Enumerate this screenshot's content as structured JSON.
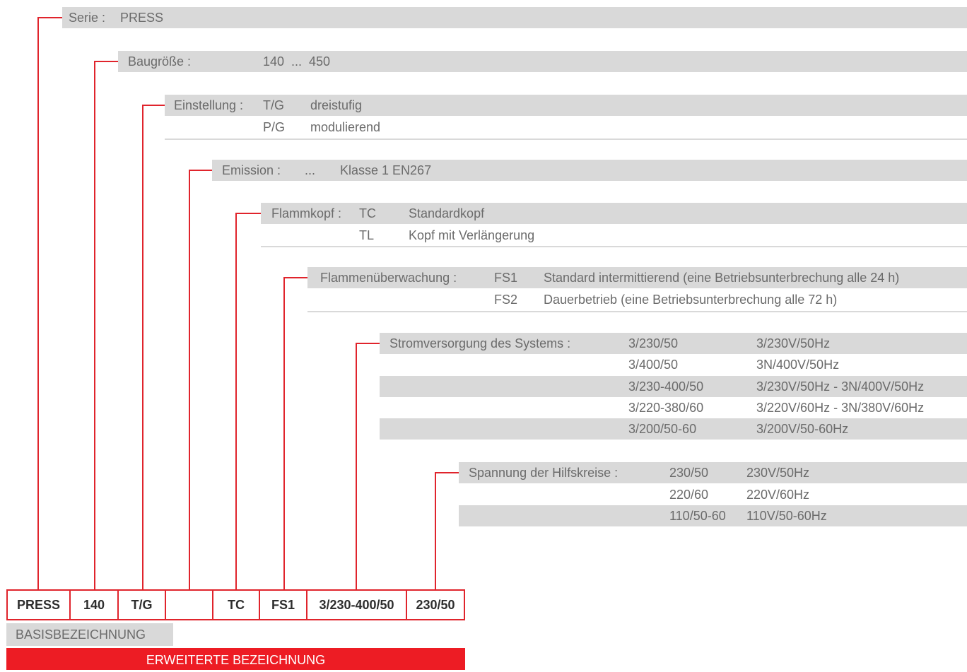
{
  "serie": {
    "label": "Serie :",
    "value": "PRESS"
  },
  "baugroesse": {
    "label": "Baugröße :",
    "value": "140  ...  450"
  },
  "einstellung": {
    "label": "Einstellung :",
    "rows": [
      {
        "code": "T/G",
        "desc": "dreistufig"
      },
      {
        "code": "P/G",
        "desc": "modulierend"
      }
    ]
  },
  "emission": {
    "label": "Emission :",
    "code": "...",
    "desc": "Klasse 1 EN267"
  },
  "flammkopf": {
    "label": "Flammkopf :",
    "rows": [
      {
        "code": "TC",
        "desc": "Standardkopf"
      },
      {
        "code": "TL",
        "desc": "Kopf mit Verlängerung"
      }
    ]
  },
  "flammen": {
    "label": "Flammenüberwachung :",
    "rows": [
      {
        "code": "FS1",
        "desc": "Standard intermittierend (eine Betriebsunterbrechung alle 24 h)"
      },
      {
        "code": "FS2",
        "desc": "Dauerbetrieb (eine Betriebsunterbrechung alle 72 h)"
      }
    ]
  },
  "strom": {
    "label": "Stromversorgung des Systems :",
    "rows": [
      {
        "code": "3/230/50",
        "desc": "3/230V/50Hz"
      },
      {
        "code": "3/400/50",
        "desc": "3N/400V/50Hz"
      },
      {
        "code": "3/230-400/50",
        "desc": "3/230V/50Hz - 3N/400V/50Hz"
      },
      {
        "code": "3/220-380/60",
        "desc": "3/220V/60Hz - 3N/380V/60Hz"
      },
      {
        "code": "3/200/50-60",
        "desc": "3/200V/50-60Hz"
      }
    ]
  },
  "hilfs": {
    "label": "Spannung der Hilfskreise :",
    "rows": [
      {
        "code": "230/50",
        "desc": "230V/50Hz"
      },
      {
        "code": "220/60",
        "desc": "220V/60Hz"
      },
      {
        "code": "110/50-60",
        "desc": "110V/50-60Hz"
      }
    ]
  },
  "code_boxes": [
    "PRESS",
    "140",
    "T/G",
    "",
    "TC",
    "FS1",
    "3/230-400/50",
    "230/50"
  ],
  "basis_label": "BASISBEZEICHNUNG",
  "erweiterte_label": "ERWEITERTE BEZEICHNUNG",
  "colors": {
    "accent": "#e0242c",
    "band": "#d9d9d9",
    "text": "#6b6b6b",
    "box_text": "#2e2e2e",
    "bar": "#ed1c24"
  }
}
